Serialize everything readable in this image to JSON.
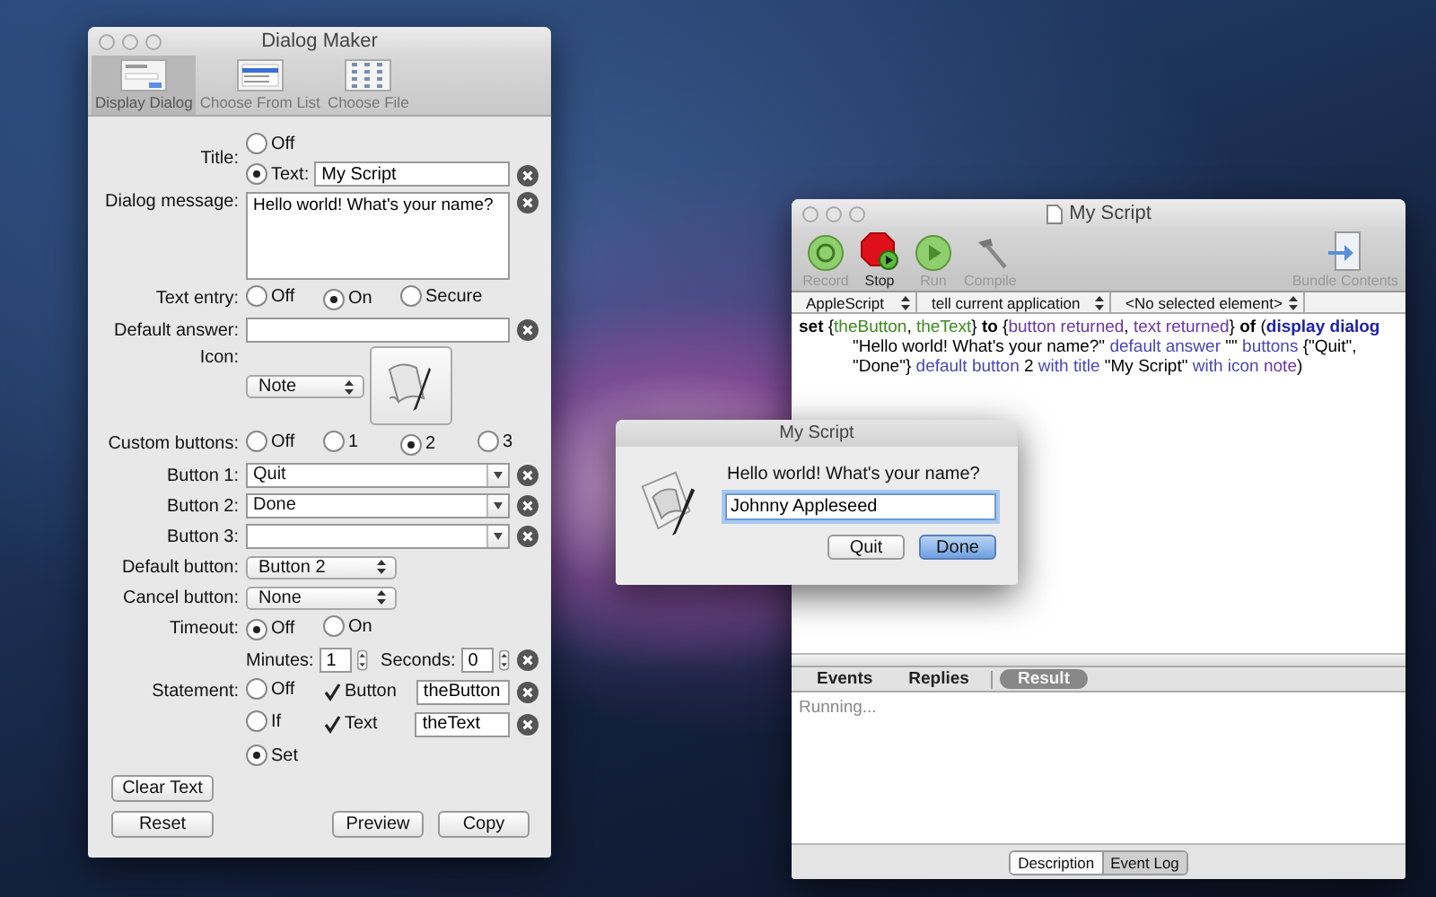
{
  "dialog_maker": {
    "title": "Dialog Maker",
    "toolbar": [
      {
        "label": "Display Dialog",
        "selected": true
      },
      {
        "label": "Choose From List",
        "selected": false
      },
      {
        "label": "Choose File",
        "selected": false
      }
    ],
    "title_row": {
      "label": "Title:",
      "options": [
        {
          "label": "Off",
          "selected": false
        },
        {
          "label": "Text:",
          "selected": true
        }
      ],
      "value": "My Script"
    },
    "dialog_message": {
      "label": "Dialog message:",
      "value": "Hello world! What's your name?"
    },
    "text_entry": {
      "label": "Text entry:",
      "options": [
        {
          "label": "Off",
          "selected": false
        },
        {
          "label": "On",
          "selected": true
        },
        {
          "label": "Secure",
          "selected": false
        }
      ]
    },
    "default_answer": {
      "label": "Default answer:"
    },
    "icon": {
      "label": "Icon:",
      "value": "Note"
    },
    "custom_buttons": {
      "label": "Custom buttons:",
      "options": [
        {
          "label": "Off",
          "selected": false
        },
        {
          "label": "1",
          "selected": false
        },
        {
          "label": "2",
          "selected": true
        },
        {
          "label": "3",
          "selected": false
        }
      ]
    },
    "button_fields": [
      {
        "label": "Button 1:",
        "value": "Quit"
      },
      {
        "label": "Button 2:",
        "value": "Done"
      },
      {
        "label": "Button 3:"
      }
    ],
    "default_button": {
      "label": "Default button:",
      "value": "Button 2"
    },
    "cancel_button": {
      "label": "Cancel button:",
      "value": "None"
    },
    "timeout": {
      "label": "Timeout:",
      "options": [
        {
          "label": "Off",
          "selected": true
        },
        {
          "label": "On",
          "selected": false
        }
      ]
    },
    "minutes": {
      "label": "Minutes:",
      "value": "1"
    },
    "seconds": {
      "label": "Seconds:",
      "value": "0"
    },
    "statement": {
      "label": "Statement:",
      "options": [
        {
          "label": "Off",
          "selected": false
        },
        {
          "label": "If",
          "selected": false
        },
        {
          "label": "Set",
          "selected": true
        }
      ],
      "checks": [
        {
          "label": "Button",
          "checked": true,
          "value": "theButton"
        },
        {
          "label": "Text",
          "checked": true,
          "value": "theText"
        }
      ]
    },
    "clear_button": "Clear Text",
    "buttons": [
      "Reset",
      "Preview",
      "Copy"
    ]
  },
  "script_editor": {
    "title": "My Script",
    "toolbar": [
      {
        "label": "Record",
        "disabled": true
      },
      {
        "label": "Stop",
        "disabled": false
      },
      {
        "label": "Run",
        "disabled": true
      },
      {
        "label": "Compile",
        "disabled": true
      },
      {
        "label": "Bundle Contents",
        "disabled": true
      }
    ],
    "navigation": [
      "AppleScript",
      "tell current application",
      "<No selected element>"
    ],
    "code": [
      {
        "text": "set",
        "kind": "keyword"
      },
      {
        "text": " {",
        "kind": "plain"
      },
      {
        "text": "theButton",
        "kind": "variable"
      },
      {
        "text": ", ",
        "kind": "plain"
      },
      {
        "text": "theText",
        "kind": "variable"
      },
      {
        "text": "} ",
        "kind": "plain"
      },
      {
        "text": "to",
        "kind": "keyword"
      },
      {
        "text": " {",
        "kind": "plain"
      },
      {
        "text": "button returned",
        "kind": "property"
      },
      {
        "text": ", ",
        "kind": "plain"
      },
      {
        "text": "text returned",
        "kind": "property"
      },
      {
        "text": "} ",
        "kind": "plain"
      },
      {
        "text": "of",
        "kind": "keyword"
      },
      {
        "text": " (",
        "kind": "plain"
      },
      {
        "text": "display dialog",
        "kind": "command"
      },
      {
        "text": " \"Hello world! What's your name?\" ",
        "kind": "plain"
      },
      {
        "text": "default answer",
        "kind": "parameter"
      },
      {
        "text": " \"\" ",
        "kind": "plain"
      },
      {
        "text": "buttons",
        "kind": "parameter"
      },
      {
        "text": " {\"Quit\", \"Done\"} ",
        "kind": "plain"
      },
      {
        "text": "default button",
        "kind": "parameter"
      },
      {
        "text": " 2 ",
        "kind": "plain"
      },
      {
        "text": "with title",
        "kind": "parameter"
      },
      {
        "text": " \"My Script\" ",
        "kind": "plain"
      },
      {
        "text": "with icon",
        "kind": "parameter"
      },
      {
        "text": " note",
        "kind": "property"
      },
      {
        "text": ")",
        "kind": "plain"
      }
    ],
    "log_tabs": [
      {
        "label": "Events",
        "selected": false
      },
      {
        "label": "Replies",
        "selected": false
      },
      {
        "label": "Result",
        "selected": true
      }
    ],
    "result": "Running...",
    "bottom_tabs": [
      {
        "label": "Description",
        "selected": false
      },
      {
        "label": "Event Log",
        "selected": true
      }
    ]
  },
  "dialog": {
    "title": "My Script",
    "message": "Hello world! What's your name?",
    "value": "Johnny Appleseed",
    "buttons": [
      {
        "label": "Quit",
        "default": false
      },
      {
        "label": "Done",
        "default": true
      }
    ]
  }
}
